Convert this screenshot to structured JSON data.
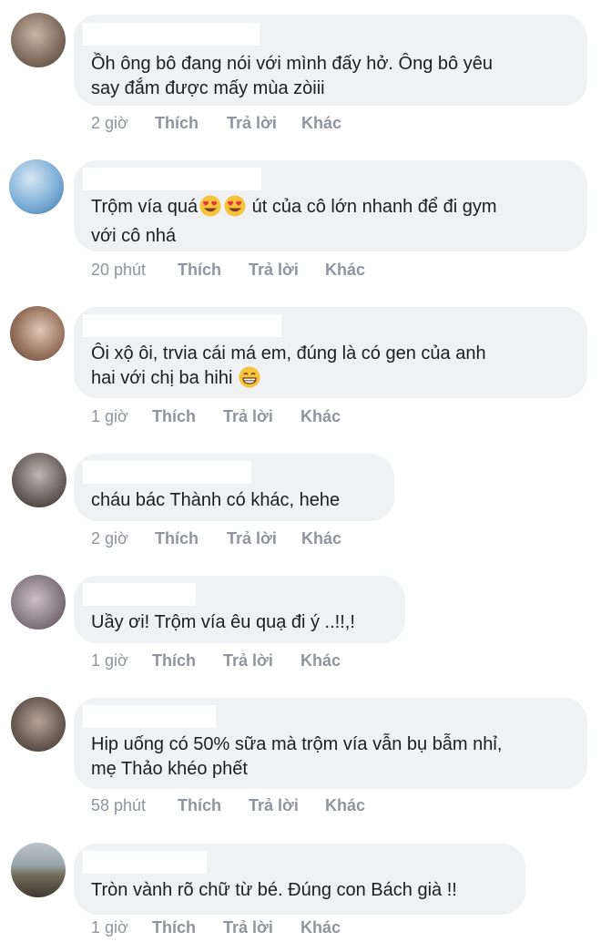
{
  "actions": {
    "like": "Thích",
    "reply": "Trả lời",
    "more": "Khác"
  },
  "colors": {
    "bubble": "#eff1f3",
    "text": "#1c1e21",
    "meta": "#90949c"
  },
  "comments": [
    {
      "lines": [
        "Ồh ông bô đang nói với mình đấy hở. Ông bô yêu",
        "say đắm được mấy mùa zòiii"
      ],
      "time": "2 giờ",
      "avatar": "avatar-photo"
    },
    {
      "lines": [
        "Trộm vía quá",
        " út của cô lớn nhanh để đi gym",
        "với cô nhá"
      ],
      "time": "20 phút",
      "avatar": "avatar-photo",
      "emoji": "heart-eyes-emoji"
    },
    {
      "lines": [
        "Ôi xộ ôi, trvia cái má em, đúng là có gen của anh",
        "hai với chị ba hihi"
      ],
      "time": "1 giờ",
      "avatar": "avatar-photo",
      "emoji": "grin-emoji"
    },
    {
      "lines": [
        "cháu bác Thành có khác, hehe"
      ],
      "time": "2 giờ",
      "avatar": "avatar-photo"
    },
    {
      "lines": [
        "Uầy ơi! Trộm vía êu quạ đi ý ..!!,!"
      ],
      "time": "1 giờ",
      "avatar": "avatar-photo"
    },
    {
      "lines": [
        "Hip uống có 50% sữa mà trộm vía vẫn bụ bẫm nhỉ,",
        "mẹ Thảo khéo phết"
      ],
      "time": "58 phút",
      "avatar": "avatar-photo"
    },
    {
      "lines": [
        "Tròn vành rõ chữ từ bé. Đúng con Bách già !!"
      ],
      "time": "1 giờ",
      "avatar": "avatar-photo"
    }
  ]
}
